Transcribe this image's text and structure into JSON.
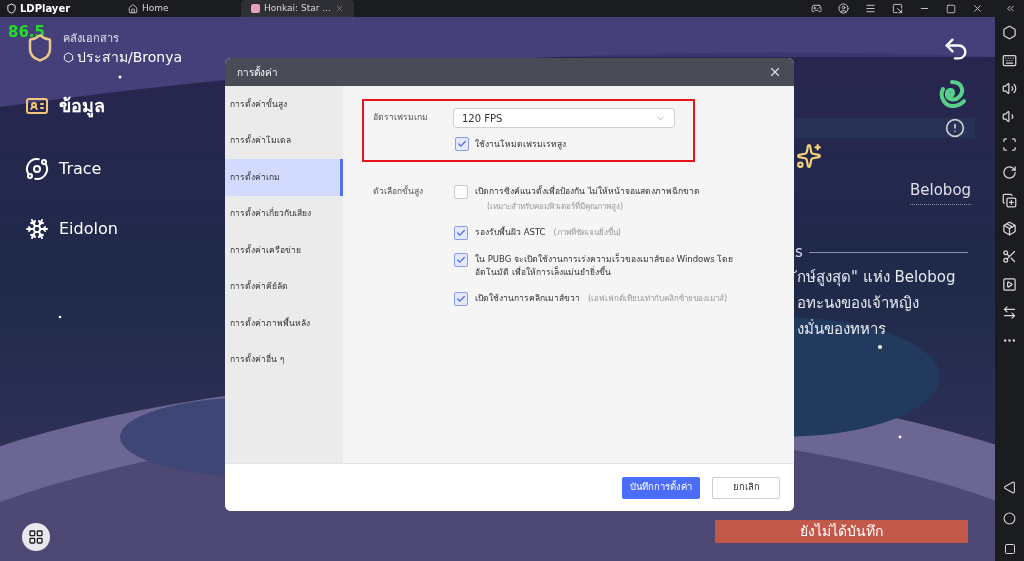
{
  "title_bar": {
    "app_name": "LDPlayer",
    "tabs": [
      {
        "label": "Home",
        "selected": false
      },
      {
        "label": "Honkai: Star ...",
        "selected": true
      }
    ]
  },
  "game": {
    "fps": "86.5",
    "archive_label": "คลังเอกสาร",
    "character": "ประสาม/Bronya",
    "menu": [
      "ข้อมูล",
      "Trace",
      "Eidolon"
    ],
    "location": "Belobog",
    "story_heading": "s",
    "story_lines": [
      "ักษ์สูงสุด\" แห่ง Belobog",
      "อทะนงของเจ้าหญิง",
      "งมั่นของทหาร"
    ],
    "status": "ยังไม่ได้บันทึก"
  },
  "dialog": {
    "title": "การตั้งค่า",
    "nav": [
      {
        "label": "การตั้งค่าขั้นสูง",
        "selected": false
      },
      {
        "label": "การตั้งค่าโมเดล",
        "selected": false
      },
      {
        "label": "การตั้งค่าเกม",
        "selected": true
      },
      {
        "label": "การตั้งค่าเกี่ยวกับเสียง",
        "selected": false
      },
      {
        "label": "การตั้งค่าเครือข่าย",
        "selected": false
      },
      {
        "label": "การตั้งค่าคีย์ลัด",
        "selected": false
      },
      {
        "label": "การตั้งค่าภาพพื้นหลัง",
        "selected": false
      },
      {
        "label": "การตั้งค่าอื่น ๆ",
        "selected": false
      }
    ],
    "frame_rate": {
      "label": "อัตราเฟรมเกม",
      "value": "120 FPS",
      "highlighted": true,
      "high_fps": {
        "label": "ใช้งานโหมดเฟรมเรทสูง",
        "checked": true
      }
    },
    "advanced": {
      "label": "ตัวเลือกขั้นสูง",
      "options": [
        {
          "label": "เปิดการซิงค์แนวตั้งเพื่อป้องกัน ไม่ให้หน้าจอแสดงภาพฉีกขาด",
          "note": "(เหมาะสำหรับคอมพิวเตอร์ที่มีคุณภาพสูง)",
          "note_below": true,
          "checked": false
        },
        {
          "label": "รองรับพื้นผิว ASTC",
          "note": "(ภาพที่ชัดเจนยิ่งขึ้น)",
          "note_below": false,
          "checked": true
        },
        {
          "label": "ใน PUBG จะเปิดใช้งานการเร่งความเร็วของเมาส์ของ Windows โดยอัตโนมัติ เพื่อให้การเล็งแม่นยำยิ่งขึ้น",
          "checked": true
        },
        {
          "label": "เปิดใช้งานการคลิกเมาส์ขวา",
          "note": "(เอฟเฟกต์เทียบเท่ากับคลิกซ้ายของเมาส์)",
          "note_below": false,
          "checked": true
        }
      ]
    },
    "buttons": [
      {
        "label": "บันทึกการตั้งค่า",
        "kind": "primary"
      },
      {
        "label": "ยกเลิก",
        "kind": "secondary"
      }
    ]
  }
}
